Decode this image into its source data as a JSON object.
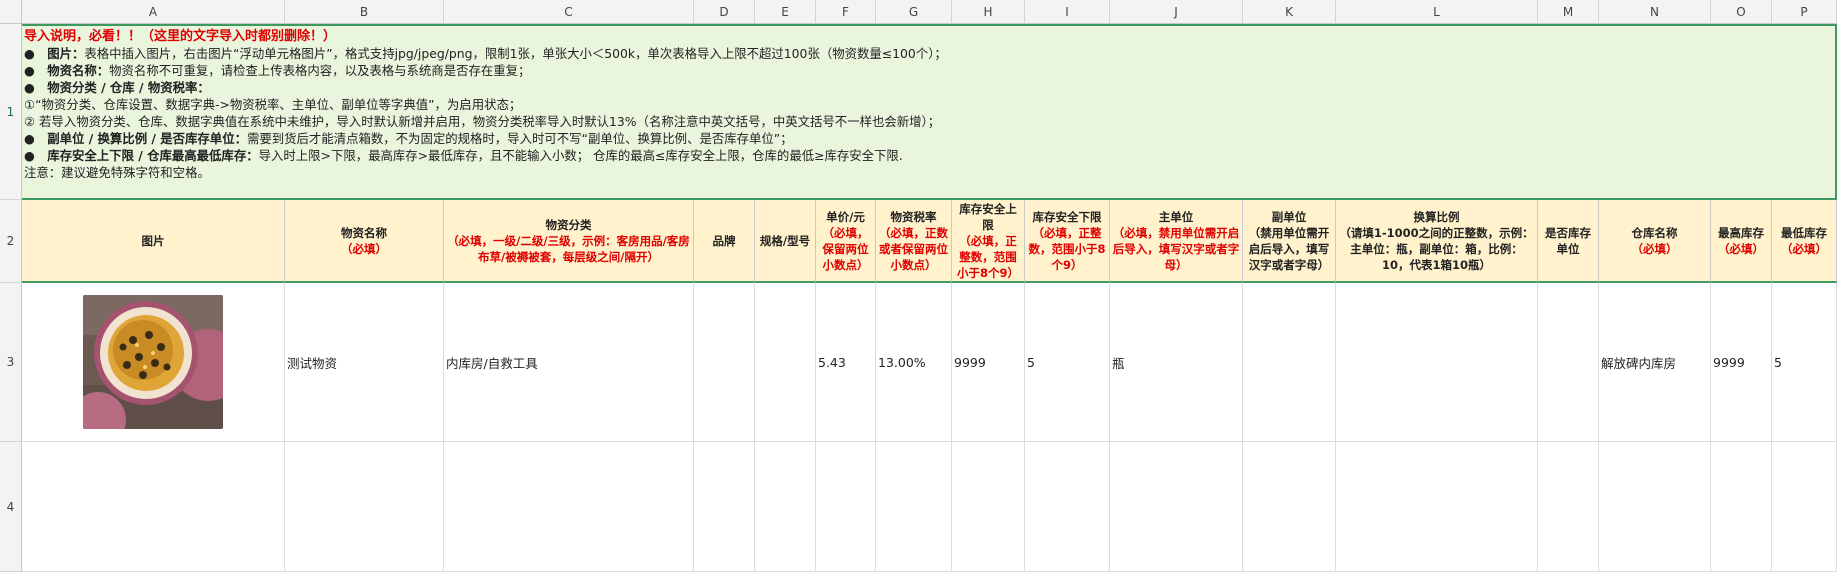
{
  "columns": [
    "A",
    "B",
    "C",
    "D",
    "E",
    "F",
    "G",
    "H",
    "I",
    "J",
    "K",
    "L",
    "M",
    "N",
    "O",
    "P"
  ],
  "rows": [
    "1",
    "2",
    "3",
    "4"
  ],
  "notes": {
    "title": "导入说明，必看！！（这里的文字导入时都别删除！）",
    "line1_bold": "●　图片：",
    "line1": "表格中插入图片，右击图片“浮动单元格图片”，格式支持jpg/jpeg/png，限制1张，单张大小＜500k，单次表格导入上限不超过100张（物资数量≤100个）；",
    "line2_bold": "●　物资名称：",
    "line2": "物资名称不可重复，请检查上传表格内容，以及表格与系统商是否存在重复；",
    "line3_bold": "●　物资分类 / 仓库 / 物资税率：",
    "line4": "①“物资分类、仓库设置、数据字典->物资税率、主单位、副单位等字典值”，为启用状态；",
    "line5": "② 若导入物资分类、仓库、数据字典值在系统中未维护，导入时默认新增并启用，物资分类税率导入时默认13%（名称注意中英文括号，中英文括号不一样也会新增）；",
    "line6_bold": "●　副单位 / 换算比例 / 是否库存单位：",
    "line6": "需要到货后才能清点箱数，不为固定的规格时，导入时可不写“副单位、换算比例、是否库存单位”；",
    "line7_bold": "●　库存安全上下限 / 仓库最高最低库存：",
    "line7": "导入时上限>下限，最高库存>最低库存，且不能输入小数； 仓库的最高≤库存安全上限，仓库的最低≥库存安全下限.",
    "line8": "注意：建议避免特殊字符和空格。"
  },
  "headers": [
    {
      "title": "图片",
      "note": ""
    },
    {
      "title": "物资名称",
      "note": "（必填）"
    },
    {
      "title": "物资分类",
      "note": "（必填，一级/二级/三级，示例：客房用品/客房布草/被褥被套，每层级之间/隔开）"
    },
    {
      "title": "品牌",
      "note": ""
    },
    {
      "title": "规格/型号",
      "note": ""
    },
    {
      "title": "单价/元",
      "note": "（必填，保留两位小数点）"
    },
    {
      "title": "物资税率",
      "note": "（必填，正数或者保留两位小数点）"
    },
    {
      "title": "库存安全上限",
      "note": "（必填，正整数，范围小于8个9）"
    },
    {
      "title": "库存安全下限",
      "note": "（必填，正整数，范围小于8个9）"
    },
    {
      "title": "主单位",
      "note": "（必填，禁用单位需开启后导入，填写汉字或者字母）"
    },
    {
      "title": "副单位",
      "note": "",
      "title2": "（禁用单位需开启后导入，填写汉字或者字母）"
    },
    {
      "title": "换算比例",
      "note": "",
      "title2": "（请填1-1000之间的正整数，示例：主单位：瓶，副单位：箱，比例：10，代表1箱10瓶）"
    },
    {
      "title": "是否库存单位",
      "note": ""
    },
    {
      "title": "仓库名称",
      "note": "（必填）"
    },
    {
      "title": "最高库存",
      "note": "（必填）"
    },
    {
      "title": "最低库存",
      "note": "（必填）"
    }
  ],
  "row3": {
    "name": "测试物资",
    "category": "内库房/自救工具",
    "brand": "",
    "spec": "",
    "price": "5.43",
    "tax": "13.00%",
    "upper": "9999",
    "lower": "5",
    "unit": "瓶",
    "subunit": "",
    "ratio": "",
    "stockunit": "",
    "warehouse": "解放碑内库房",
    "max": "9999",
    "min": "5"
  },
  "colors": {
    "notes_bg": "#e9f5dd",
    "header_bg": "#fff2cc",
    "required_text": "#e00000",
    "selection": "#3c9a5f"
  }
}
